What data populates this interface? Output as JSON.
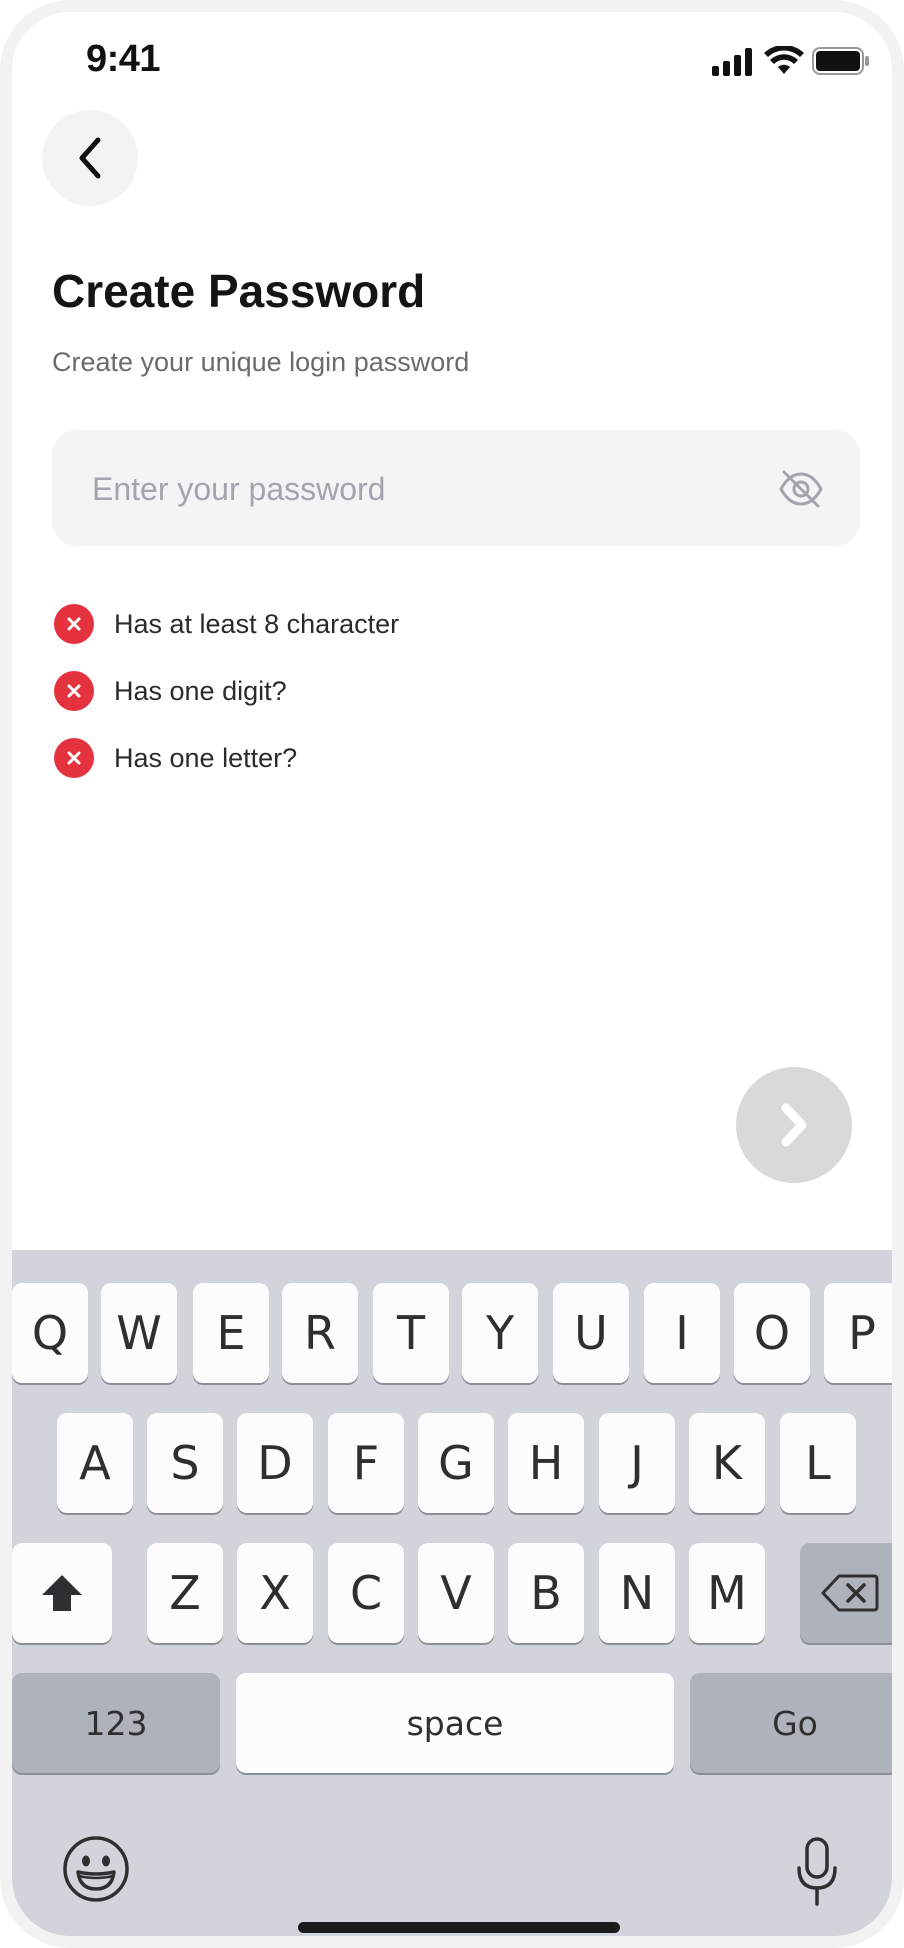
{
  "status_bar": {
    "time": "9:41"
  },
  "header": {
    "title": "Create Password",
    "subtitle": "Create your unique login password"
  },
  "password_field": {
    "value": "",
    "placeholder": "Enter your password"
  },
  "rules": [
    {
      "label": "Has at least 8 character",
      "status": "failed"
    },
    {
      "label": "Has one digit?",
      "status": "failed"
    },
    {
      "label": "Has one letter?",
      "status": "failed"
    }
  ],
  "keyboard": {
    "row1": [
      "Q",
      "W",
      "E",
      "R",
      "T",
      "Y",
      "U",
      "I",
      "O",
      "P"
    ],
    "row2": [
      "A",
      "S",
      "D",
      "F",
      "G",
      "H",
      "J",
      "K",
      "L"
    ],
    "row3": [
      "Z",
      "X",
      "C",
      "V",
      "B",
      "N",
      "M"
    ],
    "numbers_label": "123",
    "space_label": "space",
    "go_label": "Go"
  },
  "colors": {
    "error": "#e5323f",
    "keyboard_bg": "#d1d4da",
    "button_disabled": "#d9d9da"
  }
}
